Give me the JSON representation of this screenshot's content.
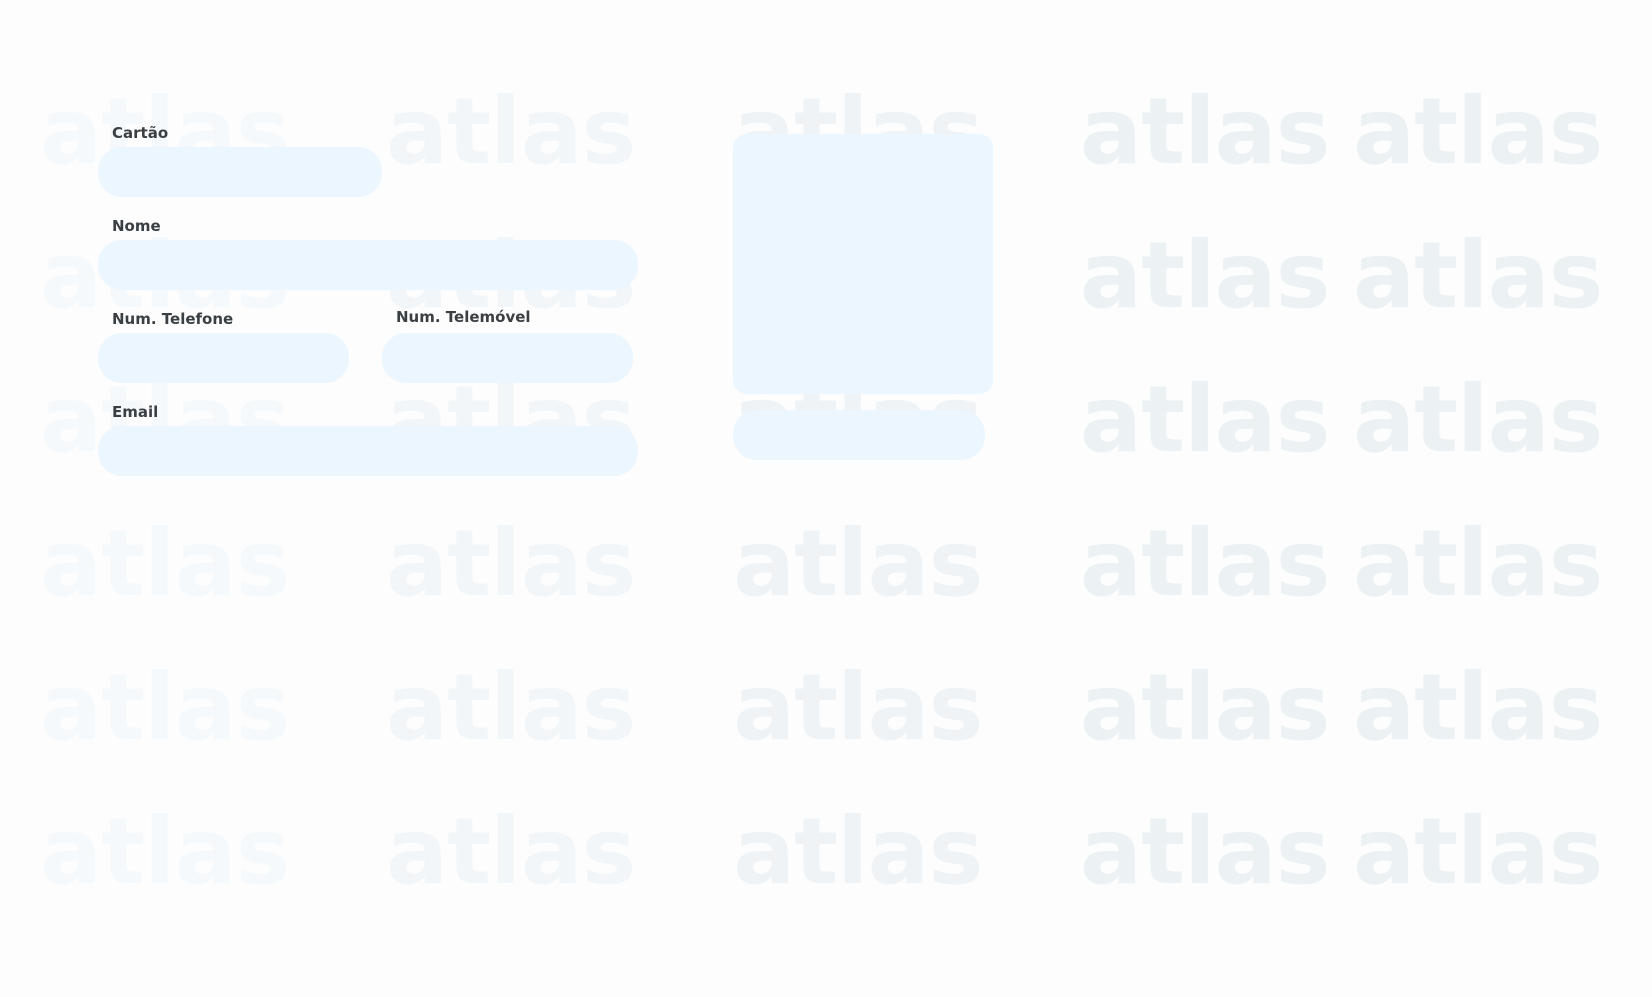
{
  "watermark": {
    "text": "atlas"
  },
  "form": {
    "card": {
      "label": "Cartão",
      "value": "",
      "placeholder": ""
    },
    "name": {
      "label": "Nome",
      "value": "",
      "placeholder": ""
    },
    "phone": {
      "label": "Num. Telefone",
      "value": "",
      "placeholder": ""
    },
    "mobile": {
      "label": "Num. Telemóvel",
      "value": "",
      "placeholder": ""
    },
    "email": {
      "label": "Email",
      "value": "",
      "placeholder": ""
    }
  },
  "photo": {
    "field_value": ""
  },
  "colors": {
    "background": "#fdfdfd",
    "field_fill": "#ebf6fe",
    "label_text": "#3a3f44",
    "watermark": "#ecf1f4"
  }
}
